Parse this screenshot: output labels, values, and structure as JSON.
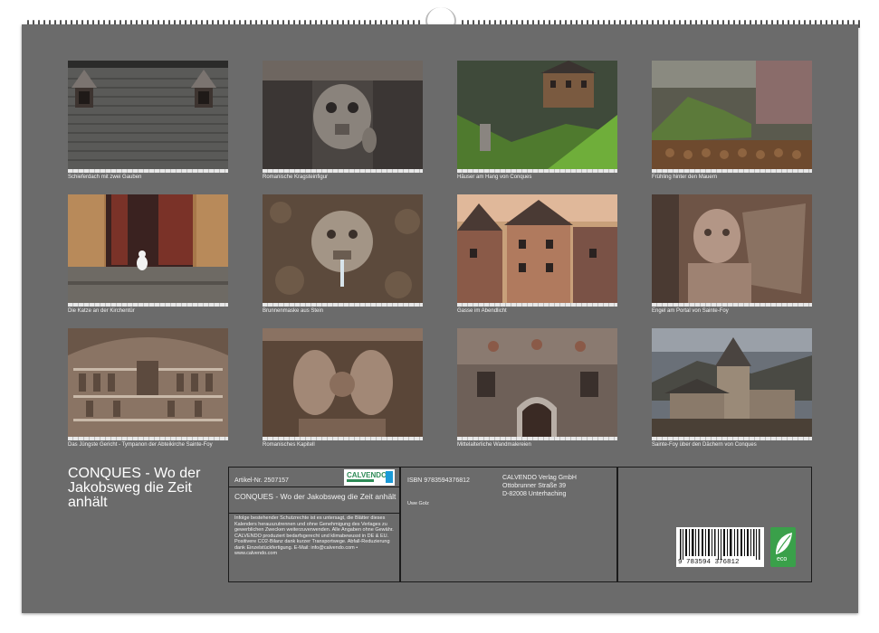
{
  "photos": [
    {
      "caption": "Schieferdach mit zwei Gauben",
      "icon": "slate-roof-image"
    },
    {
      "caption": "Romanische Kragsteinfigur",
      "icon": "stone-corbel-face-image"
    },
    {
      "caption": "Häuser am Hang von Conques",
      "icon": "hillside-houses-image"
    },
    {
      "caption": "Frühling hinter den Mauern",
      "icon": "spring-garden-image"
    },
    {
      "caption": "Die Katze an der Kirchentür",
      "icon": "cat-at-door-image"
    },
    {
      "caption": "Brunnenmaske aus Stein",
      "icon": "stone-fountain-mask-image"
    },
    {
      "caption": "Gasse im Abendlicht",
      "icon": "evening-alley-image"
    },
    {
      "caption": "Engel am Portal von Sainte-Foy",
      "icon": "angel-sculpture-image"
    },
    {
      "caption": "Das Jüngste Gericht - Tympanon der Abteikirche Sainte-Foy",
      "icon": "tympanum-image"
    },
    {
      "caption": "Romanisches Kapitell",
      "icon": "capital-birds-image"
    },
    {
      "caption": "Mittelalterliche Wandmalereien",
      "icon": "wall-paintings-image"
    },
    {
      "caption": "Sainte-Foy über den Dächern von Conques",
      "icon": "abbey-church-image"
    }
  ],
  "title": "CONQUES - Wo der Jakobsweg die Zeit anhält",
  "info": {
    "article": "Artikel-Nr. 2507157",
    "logo": "CALVENDO",
    "subtitle": "CONQUES - Wo der Jakobsweg die Zeit anhält",
    "legal": "Infolge bestehender Schutzrechte ist es untersagt, die Blätter dieses Kalenders herauszutrennen und ohne Genehmigung des Verlages zu gewerblichen Zwecken weiterzuverwenden. Alle Angaben ohne Gewähr. CALVENDO produziert bedarfsgerecht und klimabewusst in DE & EU. Positivere CO2-Bilanz dank kurzer Transportwege. Abfall-Reduzierung dank Einzelstückfertigung. E-Mail: info@calvendo.com • www.calvendo.com",
    "isbn": "ISBN 9783594376812",
    "author": "Uwe Golz",
    "publisher": [
      "CALVENDO Verlag GmbH",
      "Ottobrunner Straße 39",
      "D-82008 Unterhaching"
    ],
    "barcode_number": "9 783594 376812",
    "eco_label": "eco"
  },
  "colors": {
    "background": "#6b6b6b",
    "text": "#f2f2f2",
    "border": "#1b1b1b",
    "eco": "#3aa04a"
  }
}
